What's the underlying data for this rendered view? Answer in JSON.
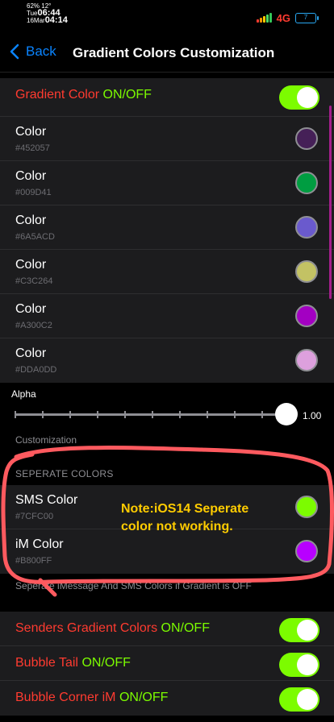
{
  "status_bar": {
    "battery_percent": "62%",
    "temperature": "12°",
    "day": "Tue",
    "time1": "06:44",
    "date": "16Mar",
    "time2": "04:14",
    "network": "4G",
    "battery_level": "7"
  },
  "nav": {
    "back_label": "Back",
    "title": "Gradient Colors Customization"
  },
  "gradient_toggle": {
    "label_part1": "Gradient Color ",
    "label_part2": "ON/OFF",
    "on": true
  },
  "colors": [
    {
      "title": "Color",
      "hex": "#452057",
      "swatch": "#452057"
    },
    {
      "title": "Color",
      "hex": "#009D41",
      "swatch": "#009D41"
    },
    {
      "title": "Color",
      "hex": "#6A5ACD",
      "swatch": "#6A5ACD"
    },
    {
      "title": "Color",
      "hex": "#C3C264",
      "swatch": "#C3C264"
    },
    {
      "title": "Color",
      "hex": "#A300C2",
      "swatch": "#A300C2"
    },
    {
      "title": "Color",
      "hex": "#DDA0DD",
      "swatch": "#DDA0DD"
    }
  ],
  "alpha": {
    "label": "Alpha",
    "value": "1.00",
    "fraction": 1.0
  },
  "customization_footer": "Customization",
  "separate": {
    "header": "SEPERATE COLORS",
    "rows": [
      {
        "title": "SMS Color",
        "hex": "#7CFC00",
        "swatch": "#7CFC00"
      },
      {
        "title": "iM Color",
        "hex": "#B800FF",
        "swatch": "#B800FF"
      }
    ],
    "footer": "Seperate iMessage And SMS Colors if Gradient is OFF"
  },
  "note": "Note:iOS14 Seperate color not working.",
  "toggles": [
    {
      "label_part1": "Senders Gradient Colors ",
      "label_part2": "ON/OFF",
      "on": true
    },
    {
      "label_part1": "Bubble Tail ",
      "label_part2": "ON/OFF",
      "on": true
    },
    {
      "label_part1": "Bubble Corner iM ",
      "label_part2": "ON/OFF",
      "on": true
    }
  ],
  "colors_theme": {
    "accent_blue": "#0a84ff",
    "toggle_green": "#7cfc00",
    "label_red": "#ff3b30",
    "note_yellow": "#ffcc00",
    "annotation_red": "#ff5a5f"
  }
}
